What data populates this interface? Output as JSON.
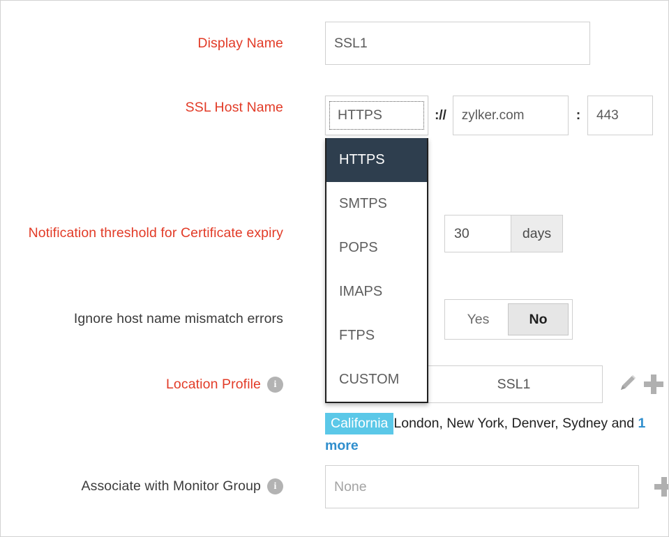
{
  "form": {
    "display_name": {
      "label": "Display Name",
      "required": true,
      "value": "SSL1"
    },
    "ssl_host_name": {
      "label": "SSL Host Name",
      "required": true,
      "protocol_value": "HTTPS",
      "scheme_separator": "://",
      "host_value": "zylker.com",
      "port_separator": ":",
      "port_value": "443",
      "dropdown_open": true,
      "dropdown_options": [
        "HTTPS",
        "SMTPS",
        "POPS",
        "IMAPS",
        "FTPS",
        "CUSTOM"
      ],
      "dropdown_selected": "HTTPS"
    },
    "notification_threshold": {
      "label": "Notification threshold for Certificate expiry",
      "required": true,
      "value": "30",
      "unit": "days"
    },
    "ignore_mismatch": {
      "label": "Ignore host name mismatch errors",
      "required": false,
      "options": [
        "Yes",
        "No"
      ],
      "selected": "No"
    },
    "location_profile": {
      "label": "Location Profile",
      "required": true,
      "info_icon": "info-icon",
      "value": "SSL1",
      "edit_icon": "pencil-icon",
      "add_icon": "plus-icon",
      "tags": {
        "highlighted": "California",
        "rest": "London, New York, Denver, Sydney and ",
        "more_link": "1 more"
      }
    },
    "monitor_group": {
      "label": "Associate with Monitor Group",
      "required": false,
      "info_icon": "info-icon",
      "placeholder": "None",
      "add_icon": "plus-icon"
    }
  },
  "colors": {
    "required_label": "#e23b27",
    "normal_label": "#3b3b3b",
    "dropdown_highlight": "#2e3e4e",
    "tag_chip": "#5bc8e8",
    "link": "#2f8ecd",
    "field_border": "#cfcfcf",
    "toggle_selected_bg": "#e6e6e6",
    "icon_gray": "#b0b0b0"
  }
}
